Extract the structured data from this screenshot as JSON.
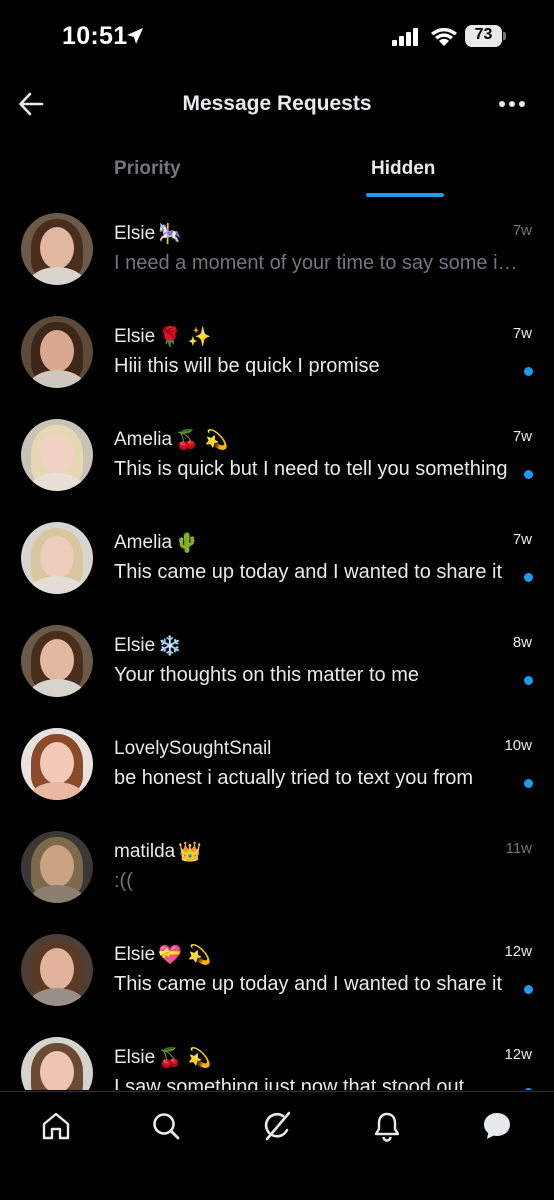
{
  "status_bar": {
    "time": "10:51",
    "battery": "73"
  },
  "header": {
    "title": "Message Requests"
  },
  "tabs": [
    {
      "label": "Priority",
      "active": false
    },
    {
      "label": "Hidden",
      "active": true
    }
  ],
  "colors": {
    "accent": "#1d9bf0",
    "background": "#000000",
    "muted_text": "#71767b",
    "primary_text": "#e7e9ea"
  },
  "messages": [
    {
      "name": "Elsie",
      "emoji": "🎠",
      "time": "7w",
      "preview": "I need a moment of your time to say some important things",
      "unread": false
    },
    {
      "name": "Elsie",
      "emoji": "🌹 ✨",
      "time": "7w",
      "preview": "Hiii this will be quick I promise",
      "unread": true
    },
    {
      "name": "Amelia",
      "emoji": "🍒 💫",
      "time": "7w",
      "preview": "This is quick but I need to tell you something",
      "unread": true
    },
    {
      "name": "Amelia",
      "emoji": "🌵",
      "time": "7w",
      "preview": "This came up today and I wanted to share it",
      "unread": true
    },
    {
      "name": "Elsie",
      "emoji": "❄️",
      "time": "8w",
      "preview": "Your thoughts on this matter to me",
      "unread": true
    },
    {
      "name": "LovelySoughtSnail",
      "emoji": "",
      "time": "10w",
      "preview": "be honest i actually tried to text you from",
      "unread": true
    },
    {
      "name": "matilda",
      "emoji": "👑",
      "time": "11w",
      "preview": ":((",
      "unread": false
    },
    {
      "name": "Elsie",
      "emoji": "💝 💫",
      "time": "12w",
      "preview": "This came up today and I wanted to share it",
      "unread": true
    },
    {
      "name": "Elsie",
      "emoji": "🍒 💫",
      "time": "12w",
      "preview": "I saw something just now that stood out",
      "unread": true
    }
  ],
  "bottom_nav": [
    {
      "icon": "home-icon"
    },
    {
      "icon": "search-icon"
    },
    {
      "icon": "grok-icon"
    },
    {
      "icon": "bell-icon"
    },
    {
      "icon": "messages-icon",
      "active": true
    }
  ]
}
